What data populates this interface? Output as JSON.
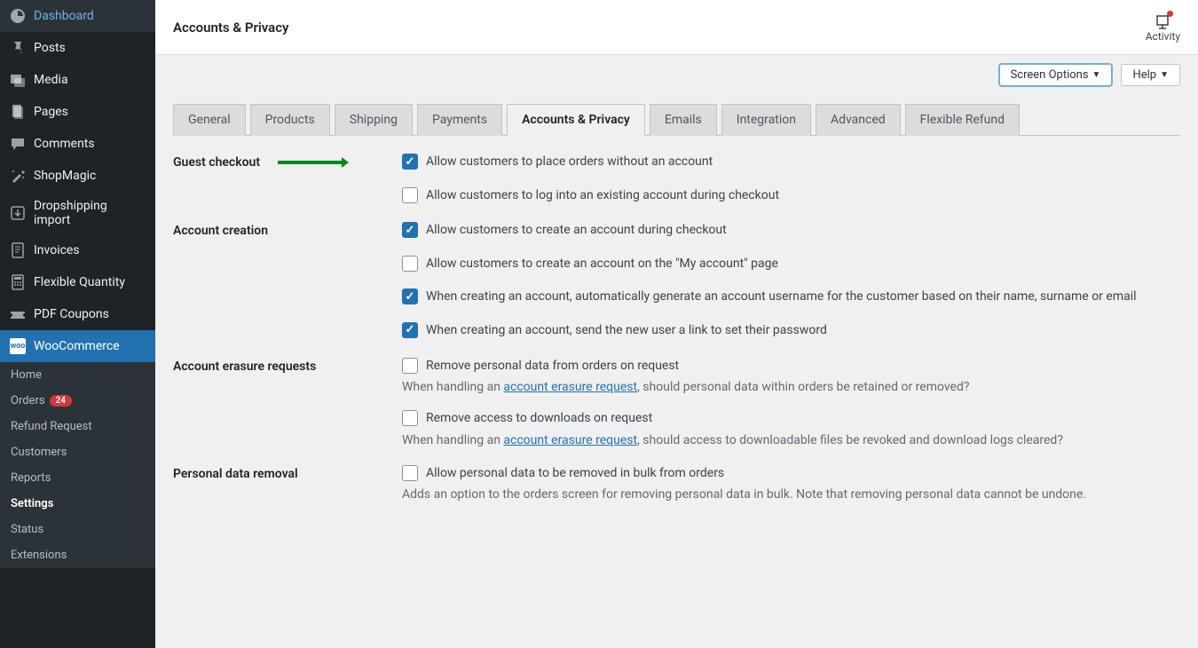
{
  "header": {
    "title": "Accounts & Privacy",
    "activity": "Activity"
  },
  "options": {
    "screen": "Screen Options",
    "help": "Help"
  },
  "sidebar": {
    "items": [
      {
        "label": "Dashboard"
      },
      {
        "label": "Posts"
      },
      {
        "label": "Media"
      },
      {
        "label": "Pages"
      },
      {
        "label": "Comments"
      },
      {
        "label": "ShopMagic"
      },
      {
        "label": "Dropshipping import"
      },
      {
        "label": "Invoices"
      },
      {
        "label": "Flexible Quantity"
      },
      {
        "label": "PDF Coupons"
      },
      {
        "label": "WooCommerce"
      }
    ],
    "sub": [
      {
        "label": "Home"
      },
      {
        "label": "Orders",
        "badge": "24"
      },
      {
        "label": "Refund Request"
      },
      {
        "label": "Customers"
      },
      {
        "label": "Reports"
      },
      {
        "label": "Settings"
      },
      {
        "label": "Status"
      },
      {
        "label": "Extensions"
      }
    ]
  },
  "tabs": [
    {
      "label": "General"
    },
    {
      "label": "Products"
    },
    {
      "label": "Shipping"
    },
    {
      "label": "Payments"
    },
    {
      "label": "Accounts & Privacy"
    },
    {
      "label": "Emails"
    },
    {
      "label": "Integration"
    },
    {
      "label": "Advanced"
    },
    {
      "label": "Flexible Refund"
    }
  ],
  "sections": {
    "guest": {
      "title": "Guest checkout",
      "opt1": "Allow customers to place orders without an account",
      "opt2": "Allow customers to log into an existing account during checkout"
    },
    "creation": {
      "title": "Account creation",
      "opt1": "Allow customers to create an account during checkout",
      "opt2": "Allow customers to create an account on the \"My account\" page",
      "opt3": "When creating an account, automatically generate an account username for the customer based on their name, surname or email",
      "opt4": "When creating an account, send the new user a link to set their password"
    },
    "erasure": {
      "title": "Account erasure requests",
      "opt1": "Remove personal data from orders on request",
      "desc1_pre": "When handling an ",
      "desc1_link": "account erasure request",
      "desc1_post": ", should personal data within orders be retained or removed?",
      "opt2": "Remove access to downloads on request",
      "desc2_pre": "When handling an ",
      "desc2_link": "account erasure request",
      "desc2_post": ", should access to downloadable files be revoked and download logs cleared?"
    },
    "removal": {
      "title": "Personal data removal",
      "opt1": "Allow personal data to be removed in bulk from orders",
      "desc1": "Adds an option to the orders screen for removing personal data in bulk. Note that removing personal data cannot be undone."
    }
  }
}
